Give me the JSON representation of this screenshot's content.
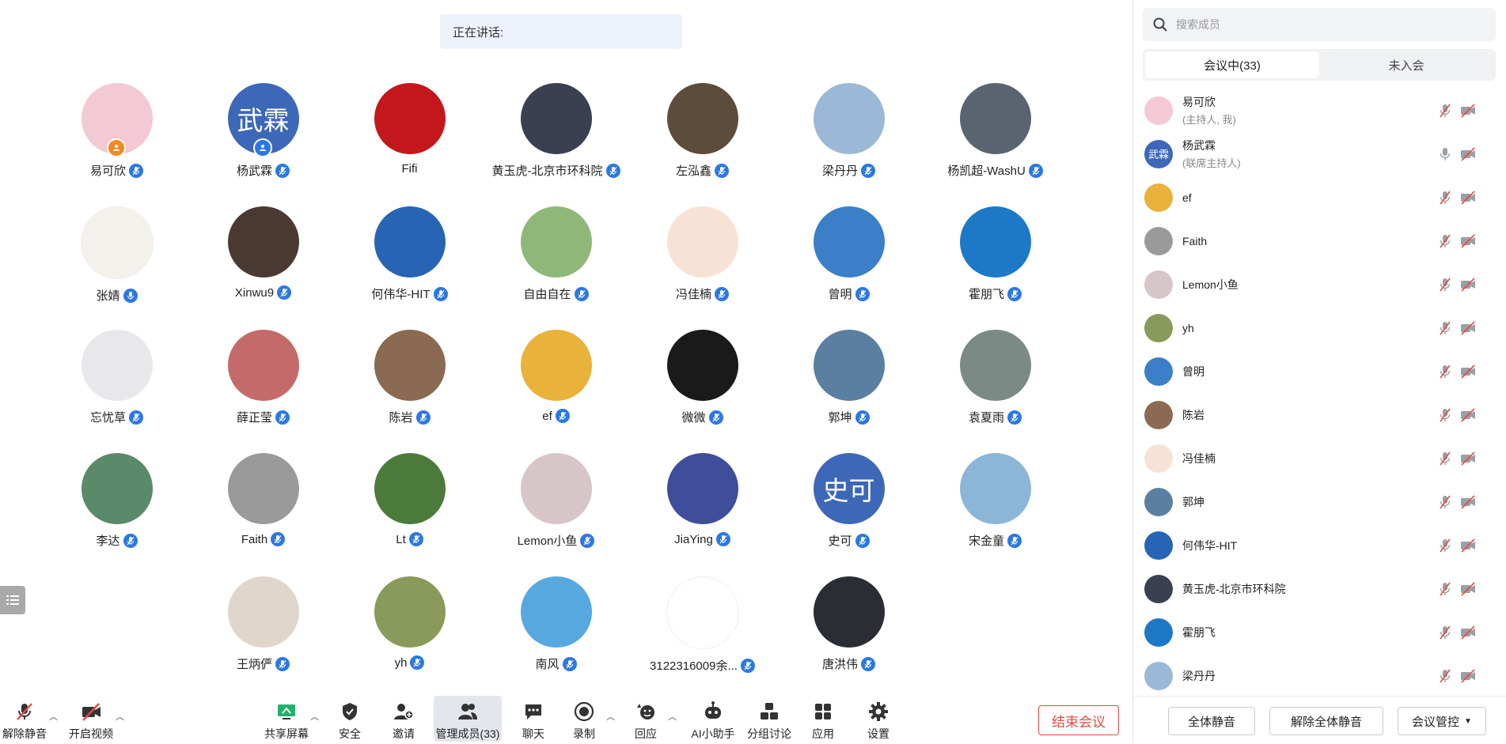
{
  "speaking": {
    "label": "正在讲话:"
  },
  "participants": [
    {
      "name": "易可欣",
      "color": "#f3c9d3",
      "badge": "host",
      "badge_color": "#f08a24"
    },
    {
      "name": "杨武霖",
      "color": "#3d68b8",
      "text": "武霖",
      "badge": "cohost",
      "badge_color": "#2b78e4"
    },
    {
      "name": "Fifi",
      "color": "#c4171c",
      "mic": false
    },
    {
      "name": "黄玉虎-北京市环科院",
      "color": "#3a4050"
    },
    {
      "name": "左泓鑫",
      "color": "#5c4c3c"
    },
    {
      "name": "梁丹丹",
      "color": "#9bb8d6"
    },
    {
      "name": "杨凯超-WashU",
      "color": "#5a6470"
    },
    {
      "name": "张婧",
      "color": "#f4f1ec",
      "mic": true
    },
    {
      "name": "Xinwu9",
      "color": "#4a3a32"
    },
    {
      "name": "何伟华-HIT",
      "color": "#2864b4"
    },
    {
      "name": "自由自在",
      "color": "#8fb878"
    },
    {
      "name": "冯佳楠",
      "color": "#f7e3d6"
    },
    {
      "name": "曾明",
      "color": "#3a7fc8"
    },
    {
      "name": "霍朋飞",
      "color": "#1e78c8"
    },
    {
      "name": "忘忧草",
      "color": "#e8e8ec"
    },
    {
      "name": "薛正莹",
      "color": "#c46a6a"
    },
    {
      "name": "陈岩",
      "color": "#8a6a52"
    },
    {
      "name": "ef",
      "color": "#e9b23a"
    },
    {
      "name": "微微",
      "color": "#1a1a1a"
    },
    {
      "name": "郭坤",
      "color": "#5a7fa0"
    },
    {
      "name": "袁夏雨",
      "color": "#7c8a86"
    },
    {
      "name": "李达",
      "color": "#5a8a6a"
    },
    {
      "name": "Faith",
      "color": "#9a9a9a"
    },
    {
      "name": "Lt",
      "color": "#4c7a3a"
    },
    {
      "name": "Lemon小鱼",
      "color": "#d7c6c8"
    },
    {
      "name": "JiaYing",
      "color": "#3e4e9a"
    },
    {
      "name": "史可",
      "color": "#3d68b8",
      "text": "史可"
    },
    {
      "name": "宋金童",
      "color": "#8cb6d8"
    },
    {
      "name": "",
      "empty": true
    },
    {
      "name": "王炳俨",
      "color": "#e0d6cc"
    },
    {
      "name": "yh",
      "color": "#8a9a5a"
    },
    {
      "name": "南风",
      "color": "#58a8e0"
    },
    {
      "name": "3122316009余...",
      "color": "#ffffff"
    },
    {
      "name": "唐洪伟",
      "color": "#2a2e34"
    }
  ],
  "toolbar": {
    "unmute": "解除静音",
    "start_video": "开启视频",
    "share_screen": "共享屏幕",
    "security": "安全",
    "invite": "邀请",
    "manage_members": "管理成员(33)",
    "chat": "聊天",
    "record": "录制",
    "react": "回应",
    "ai_assistant": "AI小助手",
    "breakout": "分组讨论",
    "apps": "应用",
    "settings": "设置",
    "end_meeting": "结束会议"
  },
  "panel": {
    "search_placeholder": "搜索成员",
    "tab_in_meeting": "会议中(33)",
    "tab_not_joined": "未入会",
    "members": [
      {
        "name": "易可欣",
        "sub": "(主持人, 我)",
        "color": "#f3c9d3",
        "mic_muted": true
      },
      {
        "name": "杨武霖",
        "sub": "(联席主持人)",
        "color": "#3d68b8",
        "text": "武霖",
        "mic_muted": false
      },
      {
        "name": "ef",
        "color": "#e9b23a",
        "mic_muted": true
      },
      {
        "name": "Faith",
        "color": "#9a9a9a",
        "mic_muted": true
      },
      {
        "name": "Lemon小鱼",
        "color": "#d7c6c8",
        "mic_muted": true
      },
      {
        "name": "yh",
        "color": "#8a9a5a",
        "mic_muted": true
      },
      {
        "name": "曾明",
        "color": "#3a7fc8",
        "mic_muted": true
      },
      {
        "name": "陈岩",
        "color": "#8a6a52",
        "mic_muted": true
      },
      {
        "name": "冯佳楠",
        "color": "#f7e3d6",
        "mic_muted": true
      },
      {
        "name": "郭坤",
        "color": "#5a7fa0",
        "mic_muted": true
      },
      {
        "name": "何伟华-HIT",
        "color": "#2864b4",
        "mic_muted": true
      },
      {
        "name": "黄玉虎-北京市环科院",
        "color": "#3a4050",
        "mic_muted": true
      },
      {
        "name": "霍朋飞",
        "color": "#1e78c8",
        "mic_muted": true
      },
      {
        "name": "梁丹丹",
        "color": "#9bb8d6",
        "mic_muted": true
      }
    ],
    "mute_all": "全体静音",
    "unmute_all": "解除全体静音",
    "meeting_control": "会议管控"
  }
}
